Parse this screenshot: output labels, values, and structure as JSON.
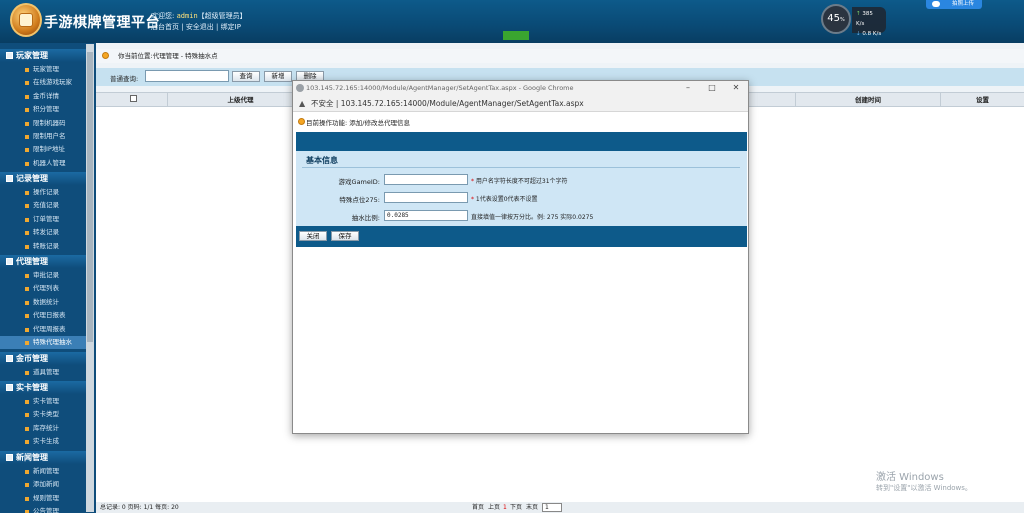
{
  "header": {
    "title": "手游棋牌管理平台",
    "welcome_prefix": "欢迎您:",
    "username": "admin",
    "role": "【超级管理员】",
    "links": [
      "后台首页",
      "安全退出",
      "绑定IP"
    ],
    "perf_percent": "45",
    "perf_unit": "%",
    "net_up": "385",
    "net_up_unit": "K/s",
    "net_down": "0.8",
    "net_down_unit": "K/s",
    "cloud_label": "拍照上传"
  },
  "sidebar": {
    "groups": [
      {
        "label": "玩家管理",
        "items": [
          "玩家管理",
          "在线游戏玩家",
          "金币详情",
          "积分管理",
          "限制机器码",
          "限制用户名",
          "限制IP地址",
          "机器人管理"
        ]
      },
      {
        "label": "记录管理",
        "items": [
          "操作记录",
          "充值记录",
          "订单管理",
          "转发记录",
          "转账记录"
        ]
      },
      {
        "label": "代理管理",
        "items": [
          "审批记录",
          "代理列表",
          "数据统计",
          "代理日报表",
          "代理周报表",
          "特殊代理抽水"
        ]
      },
      {
        "label": "金币管理",
        "items": [
          "道具管理"
        ]
      },
      {
        "label": "实卡管理",
        "items": [
          "实卡管理",
          "实卡类型",
          "库存统计",
          "实卡生成"
        ]
      },
      {
        "label": "新闻管理",
        "items": [
          "新闻管理",
          "添加新闻",
          "规则管理",
          "公告管理"
        ]
      }
    ],
    "active_item": "特殊代理抽水"
  },
  "breadcrumb": {
    "prefix": "你当前位置:",
    "path": "代理管理 - 特殊抽水点"
  },
  "search": {
    "label": "普通查询:",
    "query_button": "查询",
    "add_button": "新增",
    "delete_button": "删除"
  },
  "table": {
    "headers": [
      "上级代理",
      "创建时间",
      "设置"
    ]
  },
  "pager": {
    "summary": "总记录: 0  页码: 1/1  每页: 20",
    "first": "首页",
    "prev": "上页",
    "current": "1",
    "next": "下页",
    "last": "末页",
    "page_input": "1"
  },
  "watermark": {
    "line1": "激活 Windows",
    "line2": "转到\"设置\"以激活 Windows。"
  },
  "popup": {
    "window_title": "103.145.72.165:14000/Module/AgentManager/SetAgentTax.aspx - Google Chrome",
    "insecure_label": "不安全",
    "url": "103.145.72.165:14000/Module/AgentManager/SetAgentTax.aspx",
    "operation": "目前操作功能: 添加/修改总代理信息",
    "section_title": "基本信息",
    "fields": [
      {
        "label": "游戏GameID:",
        "value": "",
        "star": "*",
        "hint": "用户名字符长度不可超过31个字符"
      },
      {
        "label": "特殊点位275:",
        "value": "",
        "star": "*",
        "hint": "1代表设置0代表不设置"
      },
      {
        "label": "抽水比例:",
        "value": "0.0285",
        "star": "",
        "hint": "直接填值一律按万分比。例: 275 实际0.0275"
      }
    ],
    "close_button": "关闭",
    "save_button": "保存"
  },
  "colors": {
    "header_bg": "#0a4a75",
    "sidebar_bg": "#0f4d7b",
    "active_item_bg": "#3b7fb6",
    "form_bg": "#cfe6f5",
    "search_bar_bg": "#c6e1f0"
  }
}
